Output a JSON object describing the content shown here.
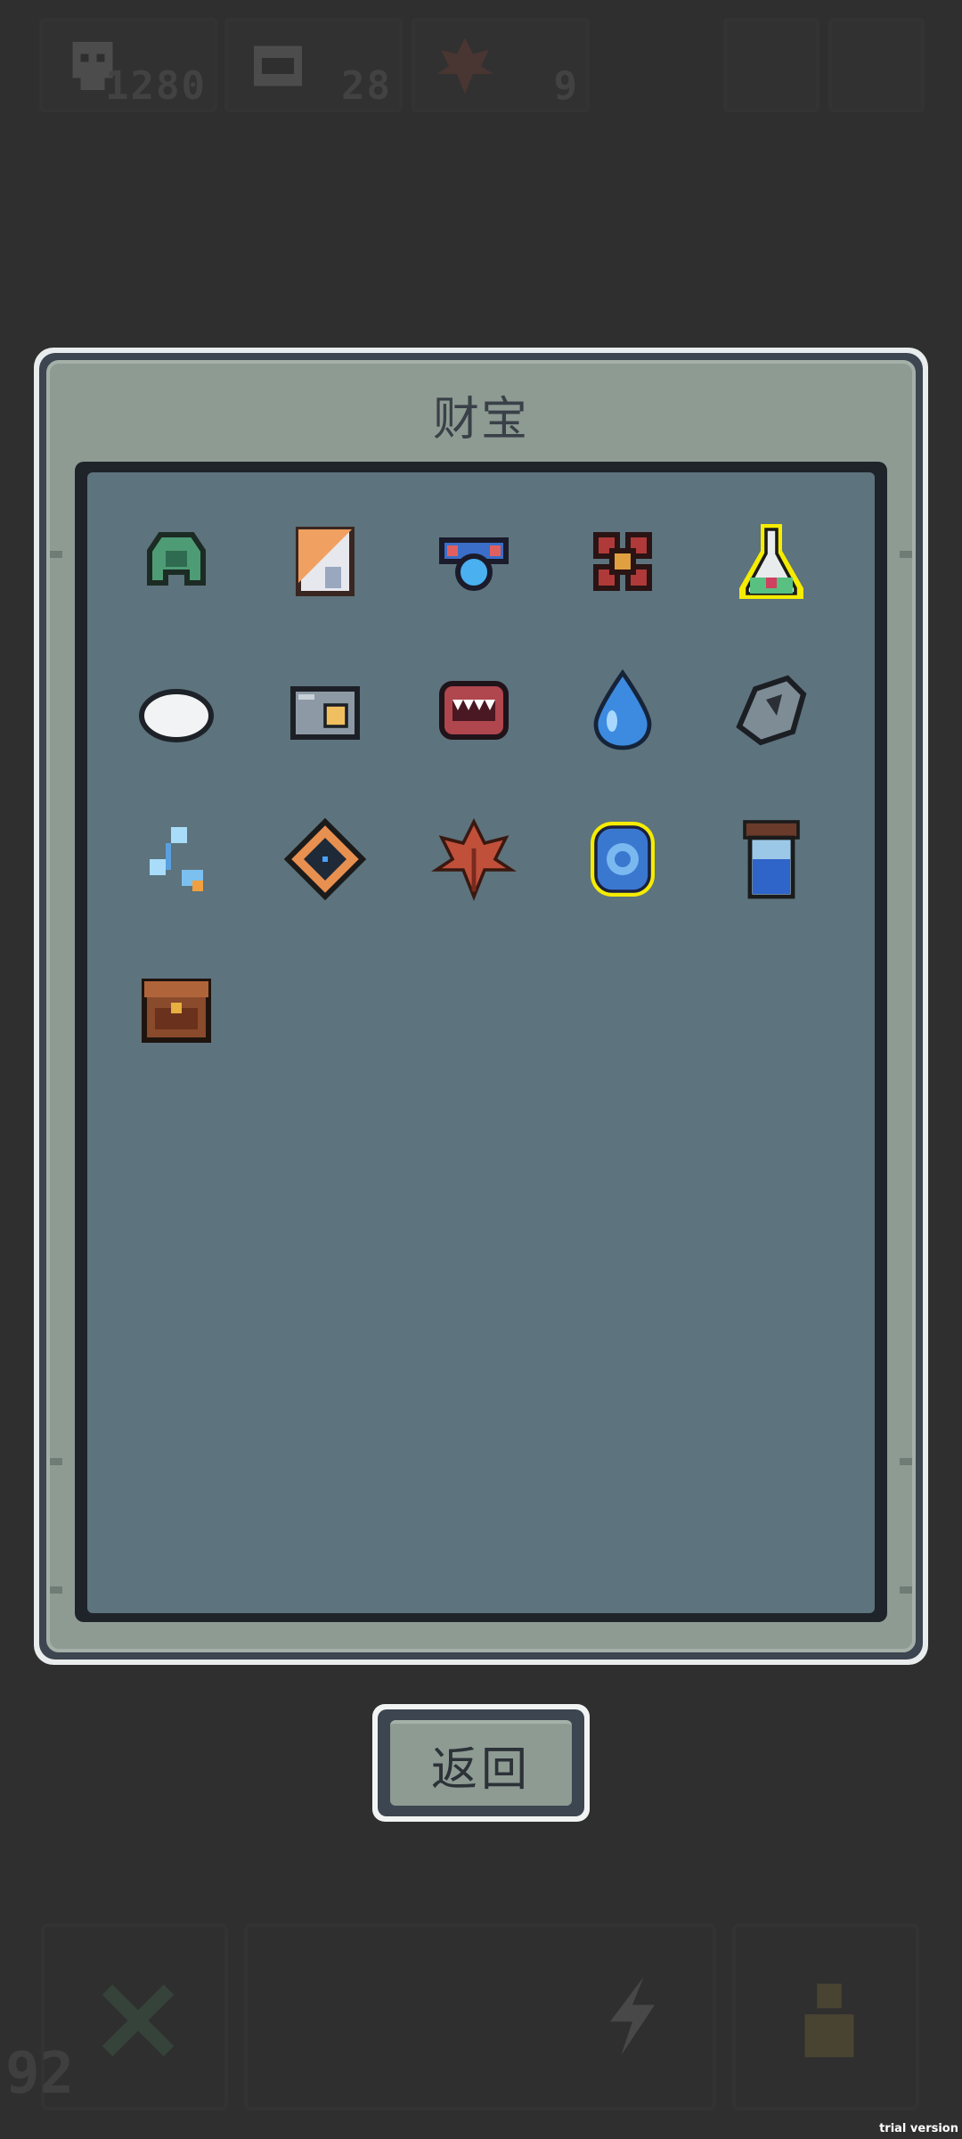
{
  "hud": {
    "resources": [
      {
        "icon": "skull-icon",
        "count": "1280"
      },
      {
        "icon": "mimic-mouth-icon",
        "count": "28"
      },
      {
        "icon": "maple-leaf-icon",
        "count": "9"
      }
    ],
    "buttons": [
      "menu-button",
      "settings-button"
    ]
  },
  "panel": {
    "title": "财宝",
    "items": [
      {
        "icon": "green-helmet-icon",
        "highlighted": false
      },
      {
        "icon": "folded-map-icon",
        "highlighted": false
      },
      {
        "icon": "blue-amulet-icon",
        "highlighted": false
      },
      {
        "icon": "red-flower-icon",
        "highlighted": false
      },
      {
        "icon": "potion-flask-icon",
        "highlighted": true
      },
      {
        "icon": "white-egg-icon",
        "highlighted": false
      },
      {
        "icon": "camera-box-icon",
        "highlighted": false
      },
      {
        "icon": "mimic-mouth-icon",
        "highlighted": false
      },
      {
        "icon": "water-drop-icon",
        "highlighted": false
      },
      {
        "icon": "stone-rock-icon",
        "highlighted": false
      },
      {
        "icon": "crystal-shards-icon",
        "highlighted": false
      },
      {
        "icon": "dark-diamond-gem-icon",
        "highlighted": false
      },
      {
        "icon": "maple-leaf-icon",
        "highlighted": false
      },
      {
        "icon": "blue-shield-orb-icon",
        "highlighted": true
      },
      {
        "icon": "blue-jar-icon",
        "highlighted": false
      },
      {
        "icon": "treasure-chest-icon",
        "highlighted": false
      }
    ]
  },
  "back_button": {
    "label": "返回"
  },
  "bottom_hud": {
    "level": "92"
  },
  "watermark": "trial version",
  "colors": {
    "background": "#2f2f2f",
    "panel_frame": "#8e9b93",
    "panel_inner": "#5d737d",
    "highlight": "#f5ec00"
  }
}
